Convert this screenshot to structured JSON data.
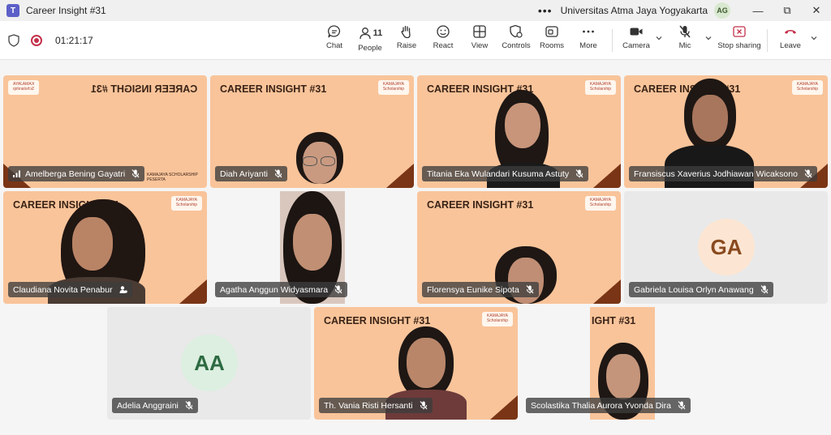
{
  "titlebar": {
    "app_title": "Career Insight #31",
    "more": "•••",
    "org": "Universitas Atma Jaya Yogyakarta",
    "avatar": "AG",
    "minimize": "—",
    "restore": "⧉",
    "close": "✕"
  },
  "toolbar": {
    "timer": "01:21:17",
    "chat": "Chat",
    "people": "People",
    "people_count": "11",
    "raise": "Raise",
    "react": "React",
    "view": "View",
    "controls": "Controls",
    "rooms": "Rooms",
    "more": "More",
    "camera": "Camera",
    "mic": "Mic",
    "stop_sharing": "Stop sharing",
    "leave": "Leave"
  },
  "banner_text": "CAREER INSIGHT #31",
  "banner_partial": "IGHT #31",
  "logo_text": "KAMAJAYA Scholarship",
  "badge_text": "KAMAJAYA SCHOLARSHIP PESERTA",
  "participants": [
    {
      "name": "Amelberga Bening Gayatri"
    },
    {
      "name": "Diah Ariyanti"
    },
    {
      "name": "Titania Eka Wulandari Kusuma Astuty"
    },
    {
      "name": "Fransiscus Xaverius Jodhiawan Wicaksono"
    },
    {
      "name": "Claudiana Novita Penabur"
    },
    {
      "name": "Agatha Anggun Widyasmara"
    },
    {
      "name": "Florensya Eunike Sipota"
    },
    {
      "name": "Gabriela Louisa Orlyn Anawang",
      "initials": "GA"
    },
    {
      "name": "Adelia Anggraini",
      "initials": "AA"
    },
    {
      "name": "Th. Vania Risti Hersanti"
    },
    {
      "name": "Scolastika Thalia Aurora Yvonda Dira"
    }
  ],
  "colors": {
    "tile_orange": "#f9c49a",
    "accent_dark": "#7a3516",
    "record_red": "#c4314b",
    "leave_red": "#c4314b"
  },
  "icons": [
    "shield-icon",
    "record-icon",
    "chat-icon",
    "people-icon",
    "raise-hand-icon",
    "react-icon",
    "view-icon",
    "controls-icon",
    "rooms-icon",
    "more-icon",
    "camera-icon",
    "mic-off-icon",
    "stop-sharing-icon",
    "leave-icon"
  ]
}
